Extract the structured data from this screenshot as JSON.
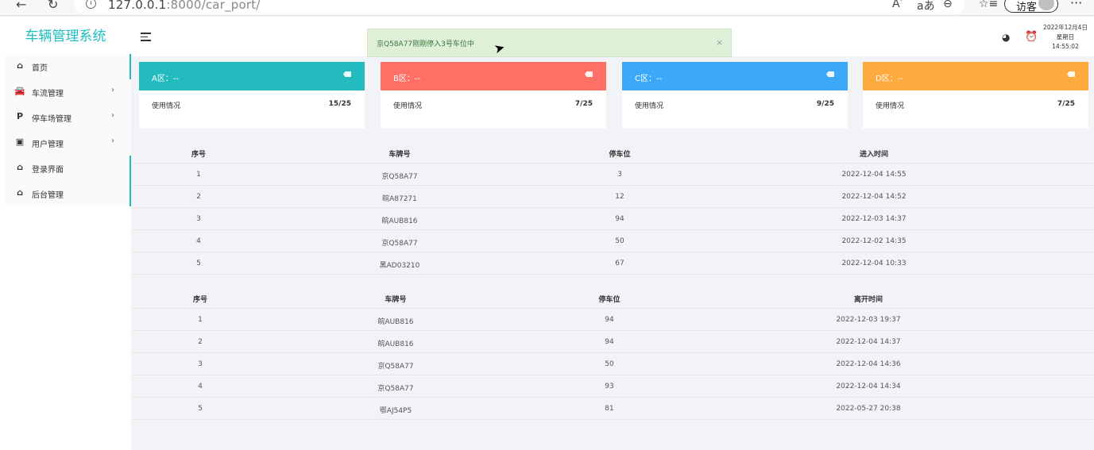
{
  "browser": {
    "back_icon": "back-arrow-icon",
    "reload_icon": "reload-icon",
    "url_host": "127.0.0.1",
    "url_path": ":8000/car_port/",
    "guest_label": "访客"
  },
  "sidebar": {
    "brand": "车辆管理系统",
    "accent_color": "#1ebdc2",
    "items": [
      {
        "label": "首页",
        "icon": "home-icon",
        "has_arrow": false
      },
      {
        "label": "车流管理",
        "icon": "car-icon",
        "has_arrow": true
      },
      {
        "label": "停车场管理",
        "icon": "parking-icon",
        "has_arrow": true
      },
      {
        "label": "用户管理",
        "icon": "user-card-icon",
        "has_arrow": true
      },
      {
        "label": "登录界面",
        "icon": "home-icon",
        "has_arrow": false
      },
      {
        "label": "后台管理",
        "icon": "home-icon",
        "has_arrow": false
      }
    ]
  },
  "header": {
    "toast": "京Q58A77刚刚停入3号车位中",
    "clock": {
      "date": "2022年12月4日",
      "weekday": "星期日",
      "time": "14:55:02"
    }
  },
  "zones": [
    {
      "title": "A区：--",
      "label": "使用情况",
      "value": "15/25",
      "color": "#23bbbd"
    },
    {
      "title": "B区：--",
      "label": "使用情况",
      "value": "7/25",
      "color": "#fe7066"
    },
    {
      "title": "C区：--",
      "label": "使用情况",
      "value": "9/25",
      "color": "#3ba9f7"
    },
    {
      "title": "D区：--",
      "label": "使用情况",
      "value": "7/25",
      "color": "#feaa3e"
    }
  ],
  "entry_table": {
    "headers": [
      "序号",
      "车牌号",
      "停车位",
      "进入时间"
    ],
    "rows": [
      [
        "1",
        "京Q58A77",
        "3",
        "2022-12-04 14:55"
      ],
      [
        "2",
        "皖A87271",
        "12",
        "2022-12-04 14:52"
      ],
      [
        "3",
        "皖AUB816",
        "94",
        "2022-12-03 14:37"
      ],
      [
        "4",
        "京Q58A77",
        "50",
        "2022-12-02 14:35"
      ],
      [
        "5",
        "黑AD03210",
        "67",
        "2022-12-04 10:33"
      ]
    ]
  },
  "exit_table": {
    "headers": [
      "序号",
      "车牌号",
      "停车位",
      "离开时间"
    ],
    "rows": [
      [
        "1",
        "皖AUB816",
        "94",
        "2022-12-03 19:37"
      ],
      [
        "2",
        "皖AUB816",
        "94",
        "2022-12-04 14:37"
      ],
      [
        "3",
        "京Q58A77",
        "50",
        "2022-12-04 14:36"
      ],
      [
        "4",
        "京Q58A77",
        "93",
        "2022-12-04 14:34"
      ],
      [
        "5",
        "鄂AJ54P5",
        "81",
        "2022-05-27 20:38"
      ]
    ]
  }
}
